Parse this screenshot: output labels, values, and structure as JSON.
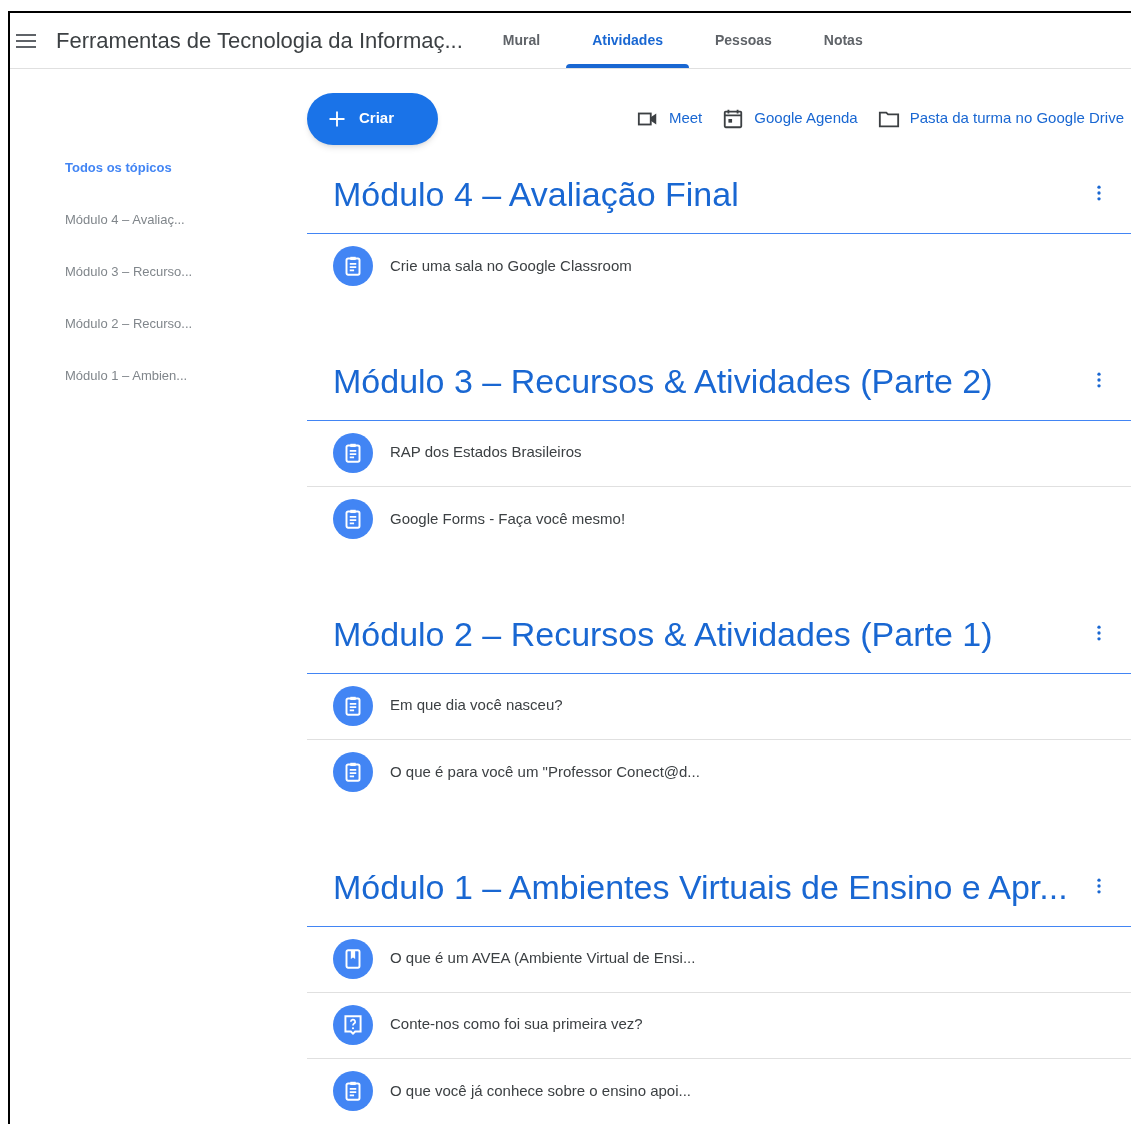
{
  "header": {
    "title": "Ferramentas de Tecnologia da Informaç...",
    "tabs": [
      {
        "label": "Mural",
        "selected": false
      },
      {
        "label": "Atividades",
        "selected": true
      },
      {
        "label": "Pessoas",
        "selected": false
      },
      {
        "label": "Notas",
        "selected": false
      }
    ]
  },
  "toolbar": {
    "create_button": "Criar",
    "links": [
      {
        "kind": "video",
        "label": "Meet"
      },
      {
        "kind": "calendar",
        "label": "Google Agenda"
      },
      {
        "kind": "folder",
        "label": "Pasta da turma no Google Drive"
      }
    ]
  },
  "sidebar": {
    "items": [
      {
        "label": "Todos os tópicos",
        "selected": true
      },
      {
        "label": "Módulo 4 – Avaliaç...",
        "selected": false
      },
      {
        "label": "Módulo 3 – Recurso...",
        "selected": false
      },
      {
        "label": "Módulo 2 – Recurso...",
        "selected": false
      },
      {
        "label": "Módulo 1 – Ambien...",
        "selected": false
      }
    ]
  },
  "topics": [
    {
      "title": "Módulo 4 – Avaliação Final",
      "items": [
        {
          "kind": "assignment",
          "title": "Crie uma sala no Google Classroom"
        }
      ]
    },
    {
      "title": "Módulo 3 – Recursos & Atividades (Parte 2)",
      "items": [
        {
          "kind": "assignment",
          "title": "RAP dos Estados Brasileiros"
        },
        {
          "kind": "assignment",
          "title": "Google Forms - Faça você mesmo!"
        }
      ]
    },
    {
      "title": "Módulo 2 – Recursos & Atividades (Parte 1)",
      "items": [
        {
          "kind": "assignment",
          "title": "Em que dia você nasceu?"
        },
        {
          "kind": "assignment",
          "title": "O que é para você um \"Professor Conect@d..."
        }
      ]
    },
    {
      "title": "Módulo 1 – Ambientes Virtuais de Ensino e Apr...",
      "items": [
        {
          "kind": "material",
          "title": "O que é um AVEA (Ambiente Virtual de Ensi..."
        },
        {
          "kind": "question",
          "title": "Conte-nos como foi sua primeira vez?"
        },
        {
          "kind": "assignment",
          "title": "O que você já conhece sobre o ensino apoi..."
        }
      ]
    }
  ]
}
